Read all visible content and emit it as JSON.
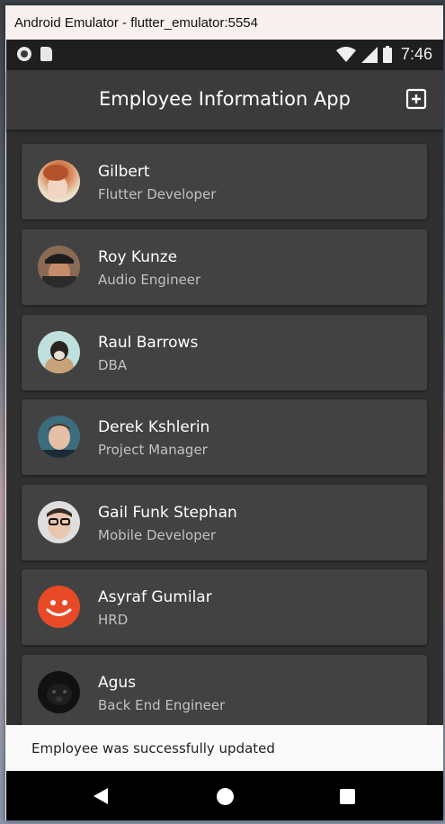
{
  "window": {
    "title": "Android Emulator - flutter_emulator:5554"
  },
  "status_bar": {
    "time": "7:46",
    "icons": [
      "notification-dot-icon",
      "sd-card-icon",
      "wifi-icon",
      "signal-icon",
      "battery-icon"
    ]
  },
  "app_bar": {
    "title": "Employee Information App",
    "action_icon": "add-box-icon"
  },
  "employees": [
    {
      "name": "Gilbert",
      "role": "Flutter Developer",
      "avatar": "photo-red-hair"
    },
    {
      "name": "Roy Kunze",
      "role": "Audio Engineer",
      "avatar": "photo-cap"
    },
    {
      "name": "Raul Barrows",
      "role": "DBA",
      "avatar": "photo-animal"
    },
    {
      "name": "Derek Kshlerin",
      "role": "Project Manager",
      "avatar": "photo-man"
    },
    {
      "name": "Gail Funk Stephan",
      "role": "Mobile Developer",
      "avatar": "photo-glasses"
    },
    {
      "name": "Asyraf Gumilar",
      "role": "HRD",
      "avatar": "smiley-icon"
    },
    {
      "name": "Agus",
      "role": "Back End Engineer",
      "avatar": "photo-dog"
    }
  ],
  "snackbar": {
    "message": "Employee was successfully updated"
  },
  "nav_bar": {
    "icons": [
      "back-icon",
      "home-icon",
      "recents-icon"
    ]
  },
  "colors": {
    "app_background": "#303030",
    "card": "#424242",
    "app_bar": "#3b3b3b",
    "avatar_accent": "#e84a27"
  }
}
